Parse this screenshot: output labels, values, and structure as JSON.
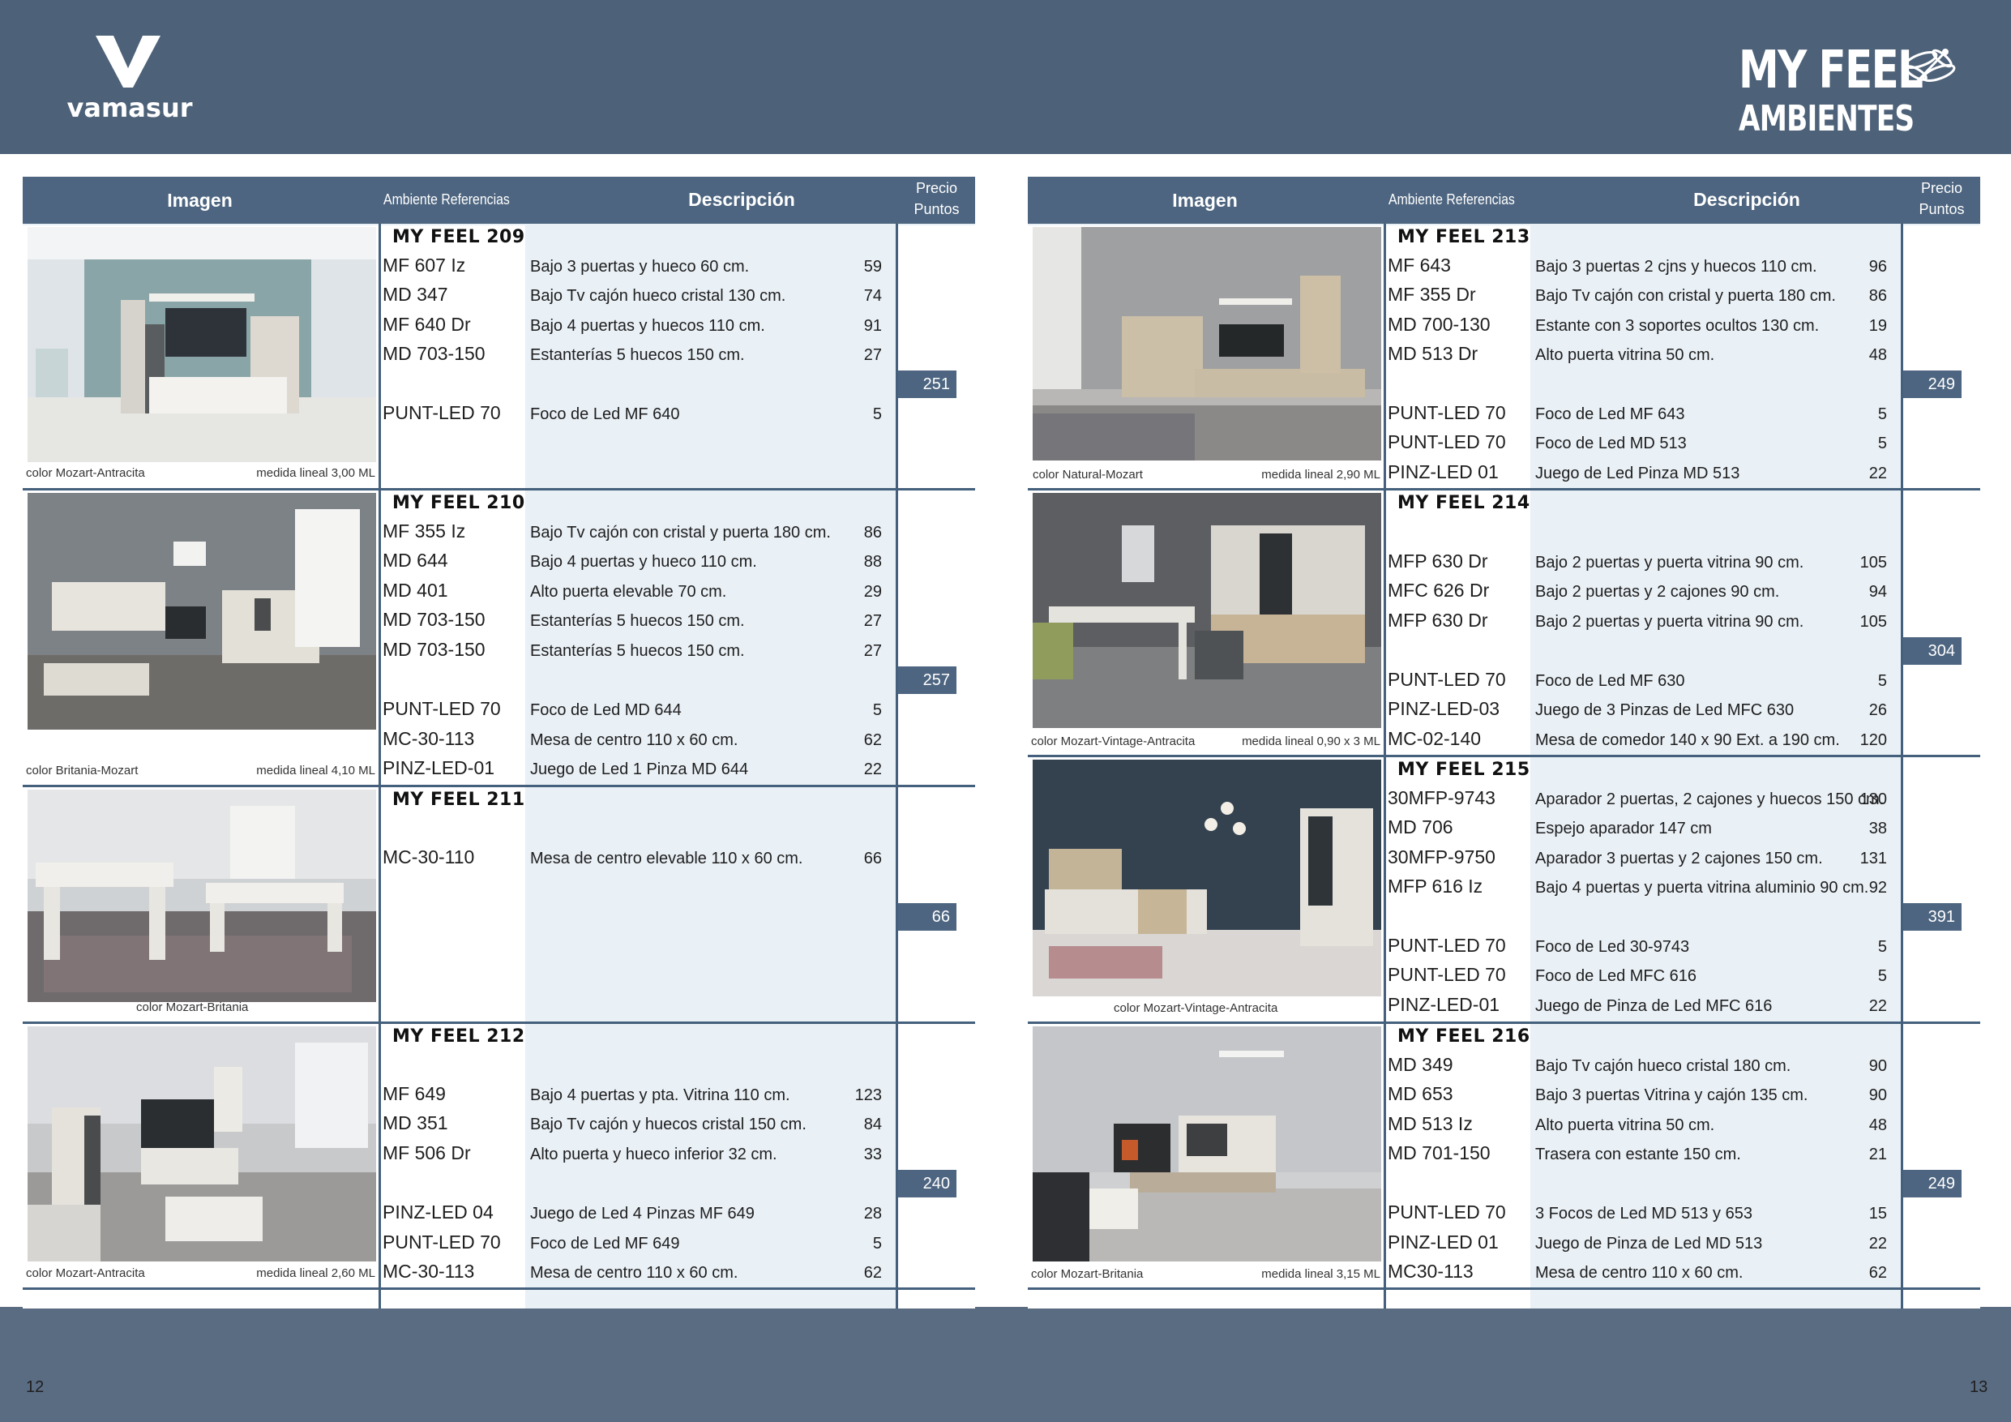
{
  "header": {
    "brand_left": "vamasur",
    "brand_right_line1": "MY FEEL",
    "brand_right_line2": "AMBIENTES"
  },
  "footer": {
    "page_left": "12",
    "page_right": "13"
  },
  "table_header": {
    "imagen": "Imagen",
    "ambiente_referencias": "Ambiente Referencias",
    "descripcion": "Descripción",
    "precio": "Precio",
    "puntos": "Puntos"
  },
  "left_page": {
    "groups": [
      {
        "name": "MY FEEL 209",
        "color_caption": "color Mozart-Antracita",
        "medida_caption": "medida lineal 3,00 ML",
        "items": [
          {
            "ref": "MF 607 Iz",
            "desc": "Bajo 3 puertas y hueco 60 cm.",
            "price": "59"
          },
          {
            "ref": "MD 347",
            "desc": "Bajo Tv cajón hueco cristal 130 cm.",
            "price": "74"
          },
          {
            "ref": "MF 640 Dr",
            "desc": "Bajo 4 puertas y huecos 110 cm.",
            "price": "91"
          },
          {
            "ref": "MD 703-150",
            "desc": "Estanterías 5 huecos 150 cm.",
            "price": "27"
          }
        ],
        "total": "251",
        "extras": [
          {
            "ref": "PUNT-LED 70",
            "desc": "Foco de Led MF 640",
            "price": "5"
          }
        ]
      },
      {
        "name": "MY FEEL 210",
        "color_caption": "color Britania-Mozart",
        "medida_caption": "medida lineal 4,10 ML",
        "items": [
          {
            "ref": "MF 355 Iz",
            "desc": "Bajo Tv cajón con cristal y puerta 180 cm.",
            "price": "86"
          },
          {
            "ref": "MD 644",
            "desc": "Bajo 4 puertas y hueco 110 cm.",
            "price": "88"
          },
          {
            "ref": "MD 401",
            "desc": "Alto puerta elevable 70 cm.",
            "price": "29"
          },
          {
            "ref": "MD 703-150",
            "desc": "Estanterías 5 huecos 150 cm.",
            "price": "27"
          },
          {
            "ref": "MD 703-150",
            "desc": "Estanterías 5 huecos 150 cm.",
            "price": "27"
          }
        ],
        "total": "257",
        "extras": [
          {
            "ref": "PUNT-LED 70",
            "desc": "Foco de Led MD 644",
            "price": "5"
          },
          {
            "ref": "MC-30-113",
            "desc": "Mesa de centro 110 x 60 cm.",
            "price": "62"
          },
          {
            "ref": "PINZ-LED-01",
            "desc": "Juego de Led 1 Pinza MD 644",
            "price": "22"
          }
        ]
      },
      {
        "name": "MY FEEL 211",
        "color_caption": "color Mozart-Britania",
        "medida_caption": "",
        "items": [
          {
            "ref": "MC-30-110",
            "desc": "Mesa de centro elevable 110 x 60 cm.",
            "price": "66"
          }
        ],
        "total": "66",
        "extras": []
      },
      {
        "name": "MY FEEL 212",
        "color_caption": "color Mozart-Antracita",
        "medida_caption": "medida lineal 2,60 ML",
        "items": [
          {
            "ref": "MF 649",
            "desc": "Bajo 4 puertas y pta. Vitrina 110 cm.",
            "price": "123"
          },
          {
            "ref": "MD 351",
            "desc": "Bajo Tv cajón y huecos cristal 150 cm.",
            "price": "84"
          },
          {
            "ref": "MF 506 Dr",
            "desc": "Alto puerta y hueco inferior 32 cm.",
            "price": "33"
          }
        ],
        "total": "240",
        "extras": [
          {
            "ref": "PINZ-LED 04",
            "desc": "Juego de Led 4 Pinzas MF 649",
            "price": "28"
          },
          {
            "ref": "PUNT-LED 70",
            "desc": "Foco de Led MF 649",
            "price": "5"
          },
          {
            "ref": "MC-30-113",
            "desc": "Mesa de centro 110 x 60 cm.",
            "price": "62"
          }
        ]
      }
    ]
  },
  "right_page": {
    "groups": [
      {
        "name": "MY FEEL 213",
        "color_caption": "color Natural-Mozart",
        "medida_caption": "medida lineal 2,90 ML",
        "items": [
          {
            "ref": "MF 643",
            "desc": "Bajo 3 puertas 2 cjns y huecos 110 cm.",
            "price": "96"
          },
          {
            "ref": "MF 355 Dr",
            "desc": "Bajo Tv cajón con cristal y puerta 180 cm.",
            "price": "86"
          },
          {
            "ref": "MD 700-130",
            "desc": "Estante con 3 soportes ocultos 130 cm.",
            "price": "19"
          },
          {
            "ref": "MD 513 Dr",
            "desc": "Alto puerta vitrina 50 cm.",
            "price": "48"
          }
        ],
        "total": "249",
        "extras": [
          {
            "ref": "PUNT-LED 70",
            "desc": "Foco de Led MF 643",
            "price": "5"
          },
          {
            "ref": "PUNT-LED 70",
            "desc": "Foco de Led MD 513",
            "price": "5"
          },
          {
            "ref": "PINZ-LED 01",
            "desc": "Juego de Led  Pinza MD 513",
            "price": "22"
          }
        ]
      },
      {
        "name": "MY FEEL 214",
        "color_caption": "color Mozart-Vintage-Antracita",
        "medida_caption": "medida lineal 0,90 x 3 ML",
        "items": [
          {
            "ref": "MFP 630 Dr",
            "desc": "Bajo 2 puertas y puerta vitrina 90 cm.",
            "price": "105"
          },
          {
            "ref": "MFC 626 Dr",
            "desc": "Bajo 2 puertas y 2 cajones  90 cm.",
            "price": "94"
          },
          {
            "ref": "MFP 630 Dr",
            "desc": "Bajo 2 puertas y puerta vitrina 90 cm.",
            "price": "105"
          }
        ],
        "total": "304",
        "extras": [
          {
            "ref": "PUNT-LED 70",
            "desc": "Foco de Led MF 630",
            "price": "5"
          },
          {
            "ref": "PINZ-LED-03",
            "desc": "Juego de 3 Pinzas de Led MFC 630",
            "price": "26"
          },
          {
            "ref": "MC-02-140",
            "desc": "Mesa de comedor 140 x 90 Ext. a 190 cm.",
            "price": "120"
          }
        ]
      },
      {
        "name": "MY FEEL 215",
        "color_caption": "color Mozart-Vintage-Antracita",
        "medida_caption": "",
        "items": [
          {
            "ref": "30MFP-9743",
            "desc": "Aparador 2 puertas, 2 cajones y huecos 150 cm.",
            "price": "130"
          },
          {
            "ref": "MD 706",
            "desc": "Espejo aparador 147 cm",
            "price": "38"
          },
          {
            "ref": "30MFP-9750",
            "desc": "Aparador 3 puertas y 2 cajones 150 cm.",
            "price": "131"
          },
          {
            "ref": "MFP 616 Iz",
            "desc": "Bajo 4 puertas y puerta vitrina aluminio 90 cm.",
            "price": "92"
          }
        ],
        "total": "391",
        "extras": [
          {
            "ref": "PUNT-LED 70",
            "desc": "Foco de Led 30-9743",
            "price": "5"
          },
          {
            "ref": "PUNT-LED 70",
            "desc": "Foco de Led MFC 616",
            "price": "5"
          },
          {
            "ref": "PINZ-LED-01",
            "desc": "Juego de Pinza de Led MFC 616",
            "price": "22"
          }
        ]
      },
      {
        "name": "MY FEEL 216",
        "color_caption": "color Mozart-Britania",
        "medida_caption": "medida lineal 3,15 ML",
        "items": [
          {
            "ref": "MD 349",
            "desc": "Bajo Tv cajón hueco cristal 180 cm.",
            "price": "90"
          },
          {
            "ref": "MD 653",
            "desc": "Bajo 3 puertas Vitrina y cajón 135 cm.",
            "price": "90"
          },
          {
            "ref": "MD 513 Iz",
            "desc": "Alto puerta vitrina 50 cm.",
            "price": "48"
          },
          {
            "ref": "MD 701-150",
            "desc": "Trasera con estante 150 cm.",
            "price": "21"
          }
        ],
        "total": "249",
        "extras": [
          {
            "ref": "PUNT-LED 70",
            "desc": "3 Focos de Led MD 513 y 653",
            "price": "15"
          },
          {
            "ref": "PINZ-LED 01",
            "desc": "Juego de Pinza de Led MD 513",
            "price": "22"
          },
          {
            "ref": "MC30-113",
            "desc": "Mesa de centro 110 x 60 cm.",
            "price": "62"
          }
        ]
      }
    ]
  }
}
